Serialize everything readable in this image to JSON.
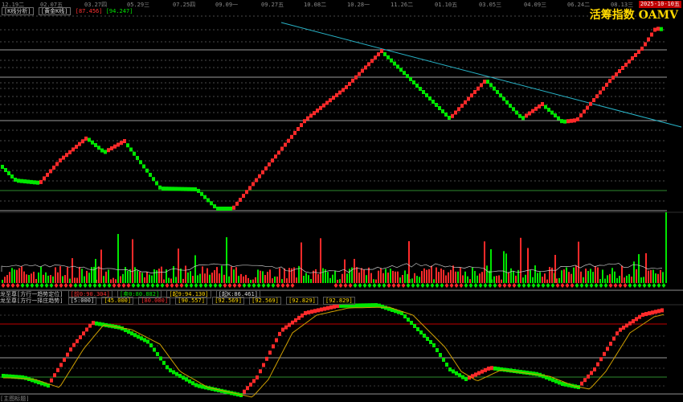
{
  "colors": {
    "up": "#ff2a2a",
    "down": "#00e600",
    "trend_line": "#28b4c8",
    "title": "#ffd800",
    "ma": "#d0a000"
  },
  "date_axis": {
    "labels": [
      "12.19二",
      "02.07五",
      "03.27四",
      "05.29三",
      "07.25四",
      "09.09一",
      "09.27五",
      "10.08二",
      "10.28一",
      "11.26二",
      "01.10五",
      "03.05三",
      "04.09三",
      "06.24二",
      "08.13三"
    ],
    "current_date": "2025-10-10五"
  },
  "header": {
    "mode_label": "[K线分析]",
    "indicator_label": "[黄金K线]",
    "value_red": "[87.456]",
    "value_green": "[94.247]"
  },
  "title": "活筹指数 OAMV",
  "indicator1": {
    "name": "龙至尊[方行一趋势定位]",
    "values": [
      "[前0:90.304]",
      "[卖0:80.882]",
      "[起9:94.130]",
      "[起K:86.461]"
    ]
  },
  "indicator2": {
    "name": "龙至尊[方行一择庄趋势]",
    "values": [
      "[5:000]",
      "[45.000]",
      "[80.000]",
      "[90.557]",
      "[92.569]",
      "[92.569]",
      "[92.829]",
      "[92.829]"
    ]
  },
  "bottom_label": "[主图标题]"
}
